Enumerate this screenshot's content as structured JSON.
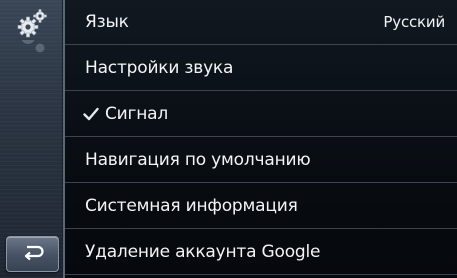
{
  "sidebar": {
    "icon": "settings-gears-icon",
    "back_icon": "back-arrow-icon"
  },
  "settings": {
    "items": [
      {
        "label": "Язык",
        "value": "Русский"
      },
      {
        "label": "Настройки звука"
      },
      {
        "label": "Сигнал",
        "checked": true
      },
      {
        "label": "Навигация по умолчанию"
      },
      {
        "label": "Системная информация"
      },
      {
        "label": "Удаление аккаунта Google"
      }
    ]
  },
  "colors": {
    "text": "#f2f4f6",
    "divider": "#3b4450",
    "sidebar": "#2a3442",
    "background": "#0a0f15"
  }
}
